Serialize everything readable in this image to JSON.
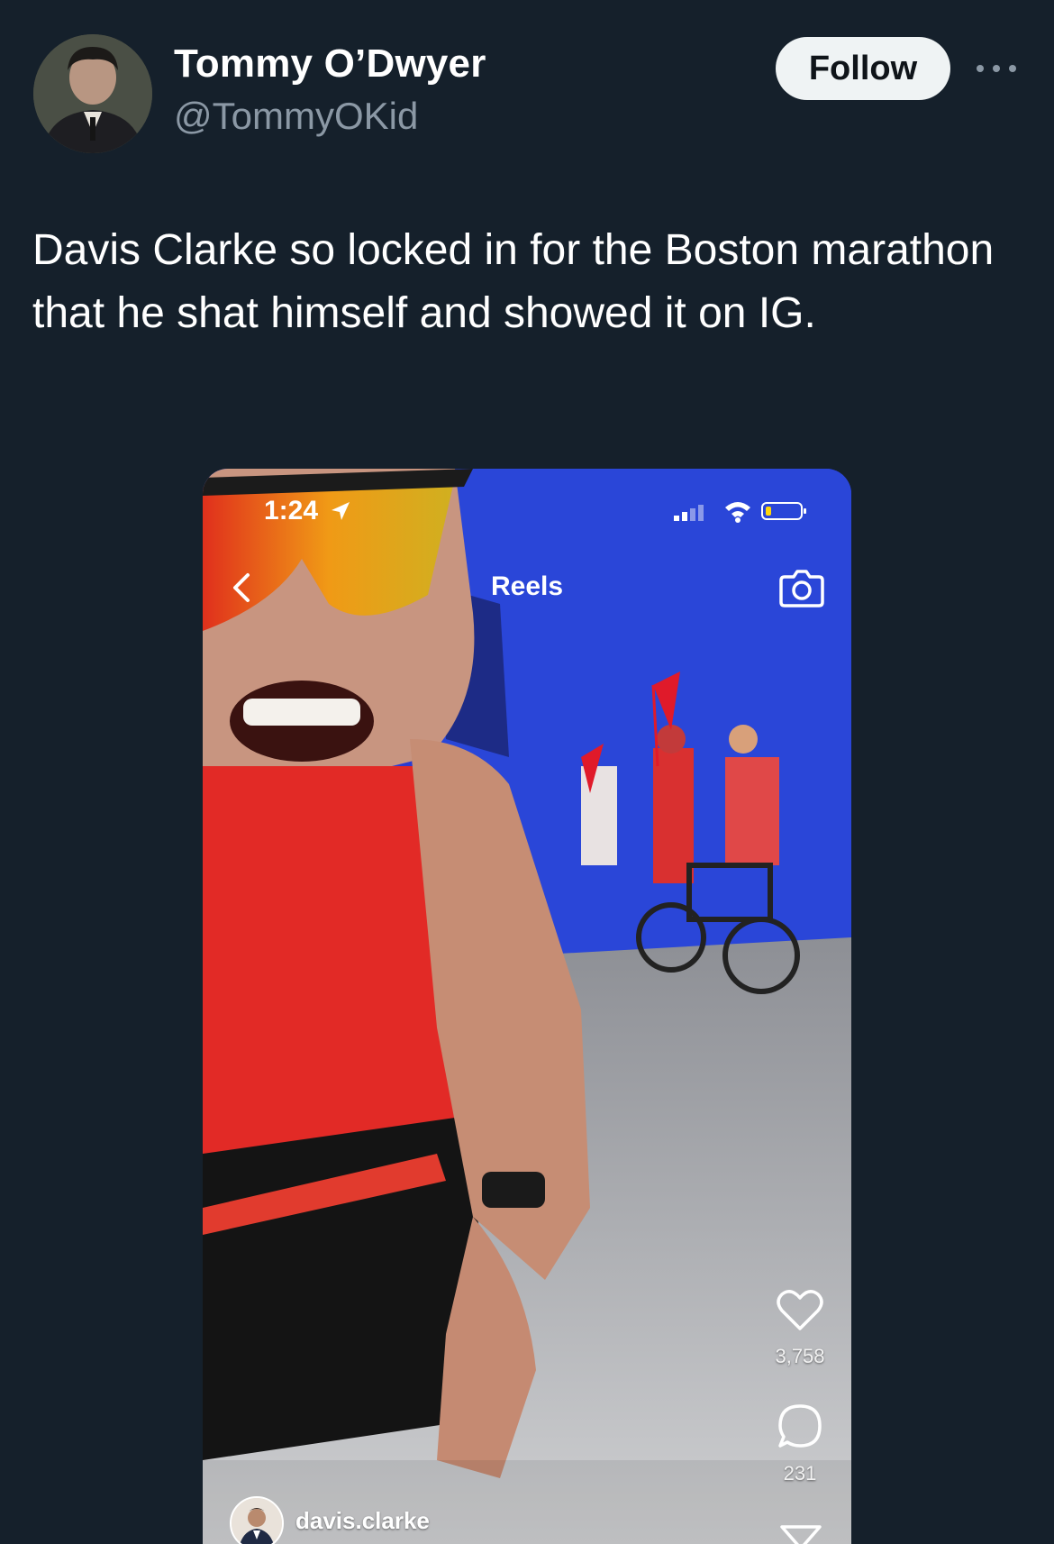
{
  "tweet": {
    "author": {
      "display_name": "Tommy O’Dwyer",
      "handle": "@TommyOKid"
    },
    "follow_label": "Follow",
    "more_icon": "more-horizontal-icon",
    "text": "Davis Clarke so locked in for the Boston marathon that he shat himself and showed it on IG."
  },
  "embedded_screenshot": {
    "status_bar": {
      "time": "1:24",
      "icons": [
        "location-arrow-icon",
        "signal-icon",
        "wifi-icon",
        "battery-icon"
      ]
    },
    "header": {
      "title": "Reels",
      "back_icon": "chevron-left-icon",
      "camera_icon": "camera-icon"
    },
    "actions": {
      "likes": "3,758",
      "comments": "231"
    },
    "author": {
      "username": "davis.clarke"
    }
  },
  "colors": {
    "background": "#15202b",
    "follow_button_bg": "#eff3f4",
    "secondary_text": "#8b98a5"
  }
}
